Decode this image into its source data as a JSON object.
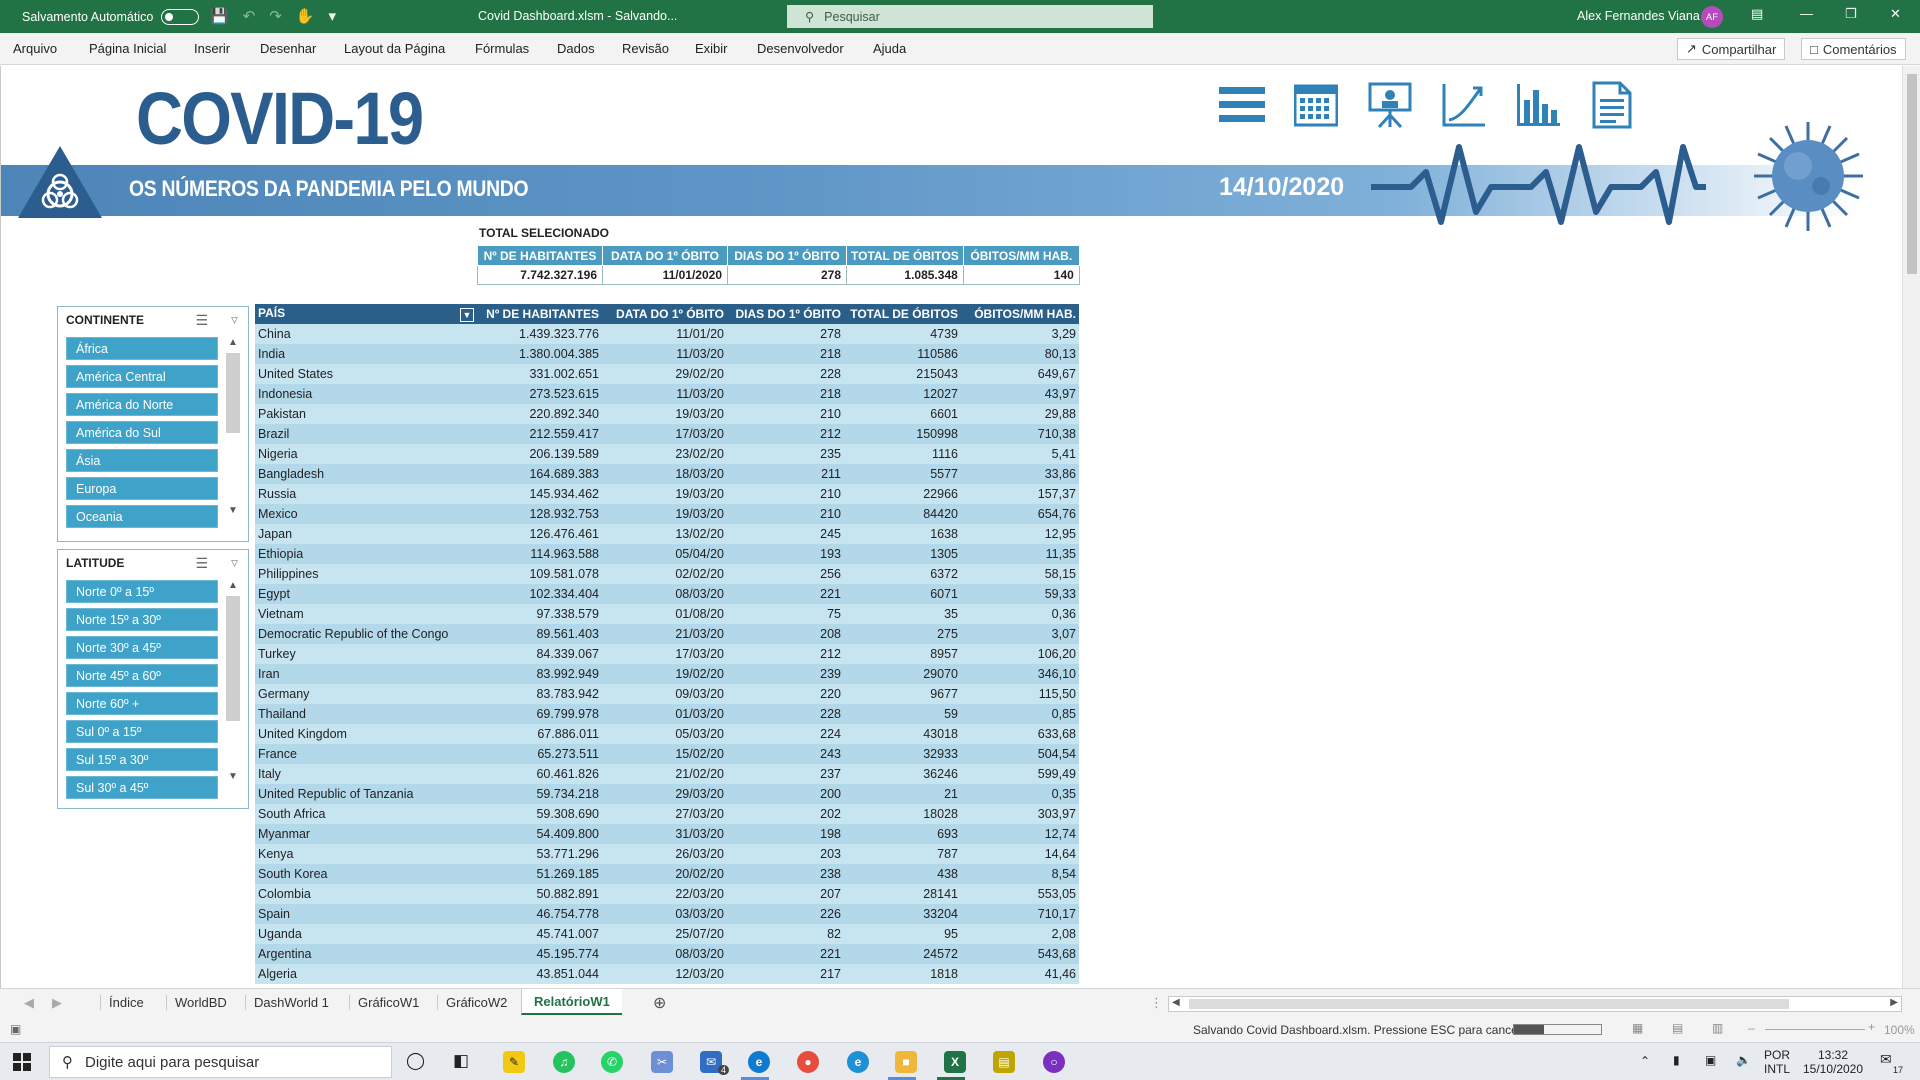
{
  "titlebar": {
    "autosave_label": "Salvamento Automático",
    "filename": "Covid Dashboard.xlsm  -  Salvando...",
    "search_placeholder": "Pesquisar",
    "user_name": "Alex Fernandes Viana",
    "user_initials": "AF"
  },
  "ribbon": {
    "tabs": [
      "Arquivo",
      "Página Inicial",
      "Inserir",
      "Desenhar",
      "Layout da Página",
      "Fórmulas",
      "Dados",
      "Revisão",
      "Exibir",
      "Desenvolvedor",
      "Ajuda"
    ],
    "share_label": "Compartilhar",
    "comments_label": "Comentários"
  },
  "banner": {
    "title": "COVID-19",
    "subtitle": "OS NÚMEROS DA PANDEMIA PELO MUNDO",
    "date": "14/10/2020",
    "nav_icons": [
      "menu-icon",
      "calendar-grid-icon",
      "presentation-icon",
      "trend-chart-icon",
      "bar-chart-icon",
      "document-icon"
    ]
  },
  "summary": {
    "label": "TOTAL SELECIONADO",
    "headers": [
      "Nº DE HABITANTES",
      "DATA DO 1º ÓBITO",
      "DIAS DO 1º ÓBITO",
      "TOTAL DE ÓBITOS",
      "ÓBITOS/MM HAB."
    ],
    "values": [
      "7.742.327.196",
      "11/01/2020",
      "278",
      "1.085.348",
      "140"
    ]
  },
  "slicers": {
    "continente": {
      "title": "CONTINENTE",
      "items": [
        "África",
        "América Central",
        "América do Norte",
        "América do Sul",
        "Ásia",
        "Europa",
        "Oceania"
      ]
    },
    "latitude": {
      "title": "LATITUDE",
      "items": [
        "Norte 0º a 15º",
        "Norte 15º a 30º",
        "Norte 30º a 45º",
        "Norte 45º a 60º",
        "Norte 60º +",
        "Sul 0º a 15º",
        "Sul 15º a 30º",
        "Sul 30º a 45º"
      ]
    }
  },
  "main_table": {
    "headers": [
      "PAÍS",
      "Nº DE HABITANTES",
      "DATA DO 1º ÓBITO",
      "DIAS DO 1º ÓBITO",
      "TOTAL DE ÓBITOS",
      "ÓBITOS/MM HAB."
    ],
    "rows": [
      [
        "China",
        "1.439.323.776",
        "11/01/20",
        "278",
        "4739",
        "3,29"
      ],
      [
        "India",
        "1.380.004.385",
        "11/03/20",
        "218",
        "110586",
        "80,13"
      ],
      [
        "United States",
        "331.002.651",
        "29/02/20",
        "228",
        "215043",
        "649,67"
      ],
      [
        "Indonesia",
        "273.523.615",
        "11/03/20",
        "218",
        "12027",
        "43,97"
      ],
      [
        "Pakistan",
        "220.892.340",
        "19/03/20",
        "210",
        "6601",
        "29,88"
      ],
      [
        "Brazil",
        "212.559.417",
        "17/03/20",
        "212",
        "150998",
        "710,38"
      ],
      [
        "Nigeria",
        "206.139.589",
        "23/02/20",
        "235",
        "1116",
        "5,41"
      ],
      [
        "Bangladesh",
        "164.689.383",
        "18/03/20",
        "211",
        "5577",
        "33,86"
      ],
      [
        "Russia",
        "145.934.462",
        "19/03/20",
        "210",
        "22966",
        "157,37"
      ],
      [
        "Mexico",
        "128.932.753",
        "19/03/20",
        "210",
        "84420",
        "654,76"
      ],
      [
        "Japan",
        "126.476.461",
        "13/02/20",
        "245",
        "1638",
        "12,95"
      ],
      [
        "Ethiopia",
        "114.963.588",
        "05/04/20",
        "193",
        "1305",
        "11,35"
      ],
      [
        "Philippines",
        "109.581.078",
        "02/02/20",
        "256",
        "6372",
        "58,15"
      ],
      [
        "Egypt",
        "102.334.404",
        "08/03/20",
        "221",
        "6071",
        "59,33"
      ],
      [
        "Vietnam",
        "97.338.579",
        "01/08/20",
        "75",
        "35",
        "0,36"
      ],
      [
        "Democratic Republic of the Congo",
        "89.561.403",
        "21/03/20",
        "208",
        "275",
        "3,07"
      ],
      [
        "Turkey",
        "84.339.067",
        "17/03/20",
        "212",
        "8957",
        "106,20"
      ],
      [
        "Iran",
        "83.992.949",
        "19/02/20",
        "239",
        "29070",
        "346,10"
      ],
      [
        "Germany",
        "83.783.942",
        "09/03/20",
        "220",
        "9677",
        "115,50"
      ],
      [
        "Thailand",
        "69.799.978",
        "01/03/20",
        "228",
        "59",
        "0,85"
      ],
      [
        "United Kingdom",
        "67.886.011",
        "05/03/20",
        "224",
        "43018",
        "633,68"
      ],
      [
        "France",
        "65.273.511",
        "15/02/20",
        "243",
        "32933",
        "504,54"
      ],
      [
        "Italy",
        "60.461.826",
        "21/02/20",
        "237",
        "36246",
        "599,49"
      ],
      [
        "United Republic of Tanzania",
        "59.734.218",
        "29/03/20",
        "200",
        "21",
        "0,35"
      ],
      [
        "South Africa",
        "59.308.690",
        "27/03/20",
        "202",
        "18028",
        "303,97"
      ],
      [
        "Myanmar",
        "54.409.800",
        "31/03/20",
        "198",
        "693",
        "12,74"
      ],
      [
        "Kenya",
        "53.771.296",
        "26/03/20",
        "203",
        "787",
        "14,64"
      ],
      [
        "South Korea",
        "51.269.185",
        "20/02/20",
        "238",
        "438",
        "8,54"
      ],
      [
        "Colombia",
        "50.882.891",
        "22/03/20",
        "207",
        "28141",
        "553,05"
      ],
      [
        "Spain",
        "46.754.778",
        "03/03/20",
        "226",
        "33204",
        "710,17"
      ],
      [
        "Uganda",
        "45.741.007",
        "25/07/20",
        "82",
        "95",
        "2,08"
      ],
      [
        "Argentina",
        "45.195.774",
        "08/03/20",
        "221",
        "24572",
        "543,68"
      ],
      [
        "Algeria",
        "43.851.044",
        "12/03/20",
        "217",
        "1818",
        "41,46"
      ]
    ]
  },
  "sheet_tabs": [
    "Índice",
    "WorldBD",
    "DashWorld 1",
    "GráficoW1",
    "GráficoW2",
    "RelatórioW1"
  ],
  "active_sheet": "RelatórioW1",
  "status": {
    "message": "Salvando Covid Dashboard.xlsm. Pressione ESC para cancelar.",
    "progress": 0.35,
    "zoom": "100%"
  },
  "taskbar": {
    "search_placeholder": "Digite aqui para pesquisar",
    "lang1": "POR",
    "lang2": "INTL",
    "time": "13:32",
    "date": "15/10/2020",
    "notif_count": "17",
    "mail_badge": "4"
  },
  "colors": {
    "excel_green": "#217346",
    "title_blue": "#2c5d8f",
    "header_navy": "#2a5f8a",
    "slicer_blue": "#3fa3c9",
    "row_light": "#c7e4f1"
  }
}
